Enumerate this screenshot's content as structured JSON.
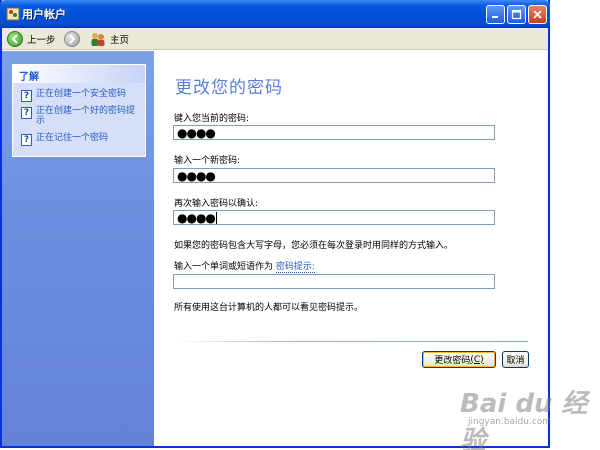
{
  "window": {
    "title": "用户帐户",
    "controls": {
      "minimize": "minimize-icon",
      "maximize": "maximize-icon",
      "close": "close-icon"
    }
  },
  "toolbar": {
    "back_label": "上一步",
    "home_label": "主页"
  },
  "sidebar": {
    "learn_title": "了解",
    "items": [
      {
        "label": "正在创建一个安全密码",
        "icon": "help-icon"
      },
      {
        "label": "正在创建一个好的密码提示",
        "icon": "help-icon"
      },
      {
        "label": "正在记住一个密码",
        "icon": "help-icon"
      }
    ]
  },
  "main": {
    "heading": "更改您的密码",
    "current_password": {
      "label": "键入您当前的密码:",
      "value": "●●●●"
    },
    "new_password": {
      "label": "输入一个新密码:",
      "value": "●●●●"
    },
    "confirm_password": {
      "label": "再次输入密码以确认:",
      "value": "●●●●"
    },
    "case_note": "如果您的密码包含大写字母，您必须在每次登录时用同样的方式输入。",
    "hint_label": "输入一个单词或短语作为",
    "hint_link": "密码提示:",
    "hint_value": "",
    "hint_note": "所有使用这台计算机的人都可以看见密码提示。",
    "change_button": {
      "text": "更改密码",
      "shortcut": "(C)"
    },
    "cancel_button": "取消"
  },
  "watermark": {
    "brand": "Bai du 经验",
    "url": "jingyan.baidu.com"
  },
  "colors": {
    "titlebar": "#0050d8",
    "sidebar": "#6c8fe0",
    "heading": "#5a7edc",
    "link": "#215dc6"
  }
}
